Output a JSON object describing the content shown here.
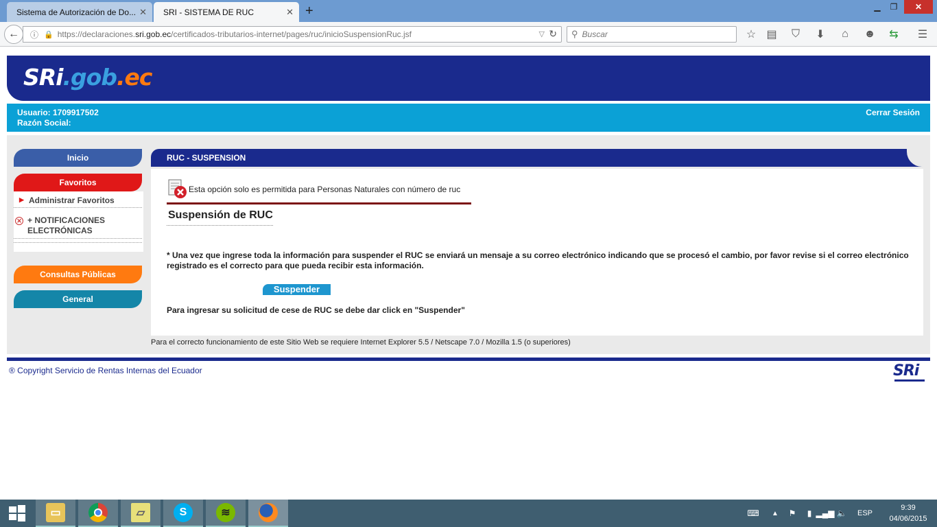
{
  "browser": {
    "tabs": [
      {
        "label": "Sistema de Autorización de Do...",
        "active": false
      },
      {
        "label": "SRI - SISTEMA DE RUC",
        "active": true
      }
    ],
    "url_prefix": "https://declaraciones.",
    "url_domain": "sri.gob.ec",
    "url_path": "/certificados-tributarios-internet/pages/ruc/inicioSuspensionRuc.jsf",
    "search_placeholder": "Buscar"
  },
  "header": {
    "logo_part1": "SRi",
    "logo_part2": ".gob",
    "logo_part3": ".ec"
  },
  "userbar": {
    "user_line": "Usuario: 1709917502",
    "razon_line": "Razón Social:",
    "logout_label": "Cerrar Sesión"
  },
  "sidebar": {
    "inicio": "Inicio",
    "favoritos": "Favoritos",
    "admin_favoritos": "Administrar Favoritos",
    "notificaciones_line1": "+ NOTIFICACIONES",
    "notificaciones_line2": "ELECTRÓNICAS",
    "consultas": "Consultas Públicas",
    "general": "General"
  },
  "main": {
    "panel_title": "RUC - SUSPENSION",
    "warning": "Esta opción solo es permitida para Personas Naturales con número de ruc",
    "section_title": "Suspensión de RUC",
    "info": "* Una vez que ingrese toda la información para suspender el RUC se enviará un mensaje a su correo electrónico indicando que se procesó el cambio, por favor revise si el correo electrónico registrado es el correcto para que pueda recibir esta información.",
    "suspend_button": "Suspender",
    "cese_text": "Para ingresar su solicitud de cese de RUC se debe dar click en \"Suspender\"",
    "requirements": "Para el correcto funcionamiento de este Sitio Web se requiere Internet Explorer 5.5 / Netscape 7.0 / Mozilla 1.5 (o superiores)"
  },
  "footer": {
    "copyright": "® Copyright Servicio de Rentas Internas del Ecuador",
    "logo": "SRi"
  },
  "taskbar": {
    "apps": [
      "file-explorer-icon",
      "chrome-icon",
      "sticky-notes-icon",
      "skype-icon",
      "spotify-icon",
      "firefox-icon"
    ],
    "language": "ESP",
    "time": "9:39",
    "date": "04/06/2015"
  },
  "colors": {
    "sri_blue": "#1a2a8d",
    "sri_cyan": "#0ba1d6",
    "favoritos_red": "#e01818",
    "consultas_orange": "#ff7a10"
  }
}
